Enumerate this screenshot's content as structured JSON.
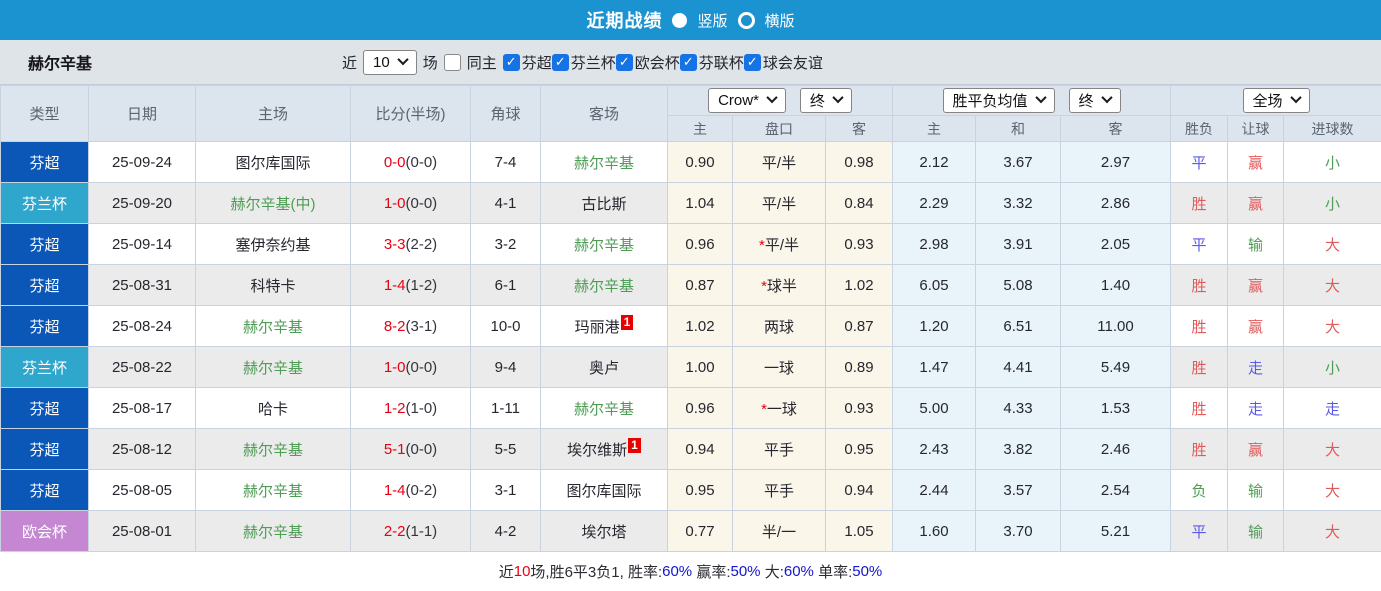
{
  "topbar": {
    "title": "近期战绩",
    "radio_vertical_label": "竖版",
    "radio_horizontal_label": "横版"
  },
  "filter": {
    "team": "赫尔辛基",
    "near_label": "近",
    "count_value": "10",
    "games_label": "场",
    "same_home_label": "同主",
    "leagues": [
      "芬超",
      "芬兰杯",
      "欧会杯",
      "芬联杯",
      "球会友谊"
    ]
  },
  "colors": {
    "topbar_blue": "#1c93d1",
    "league_super": "#0b57b8",
    "league_finnish_cup": "#2fa7cd",
    "league_conference": "#c687d2",
    "checkbox_blue": "#1673e6",
    "score_red": "#e60012",
    "team_green": "#4e9d55",
    "result_red": "#e05a5a",
    "result_blue": "#5a5ae6",
    "result_green": "#4e9d55",
    "footer_blue": "#1414cc"
  },
  "table": {
    "headers": {
      "type": "类型",
      "date": "日期",
      "home": "主场",
      "score": "比分(半场)",
      "corner": "角球",
      "away": "客场"
    },
    "controls": {
      "bookmaker": "Crow*",
      "final1": "终",
      "mean": "胜平负均值",
      "final2": "终",
      "fulltime": "全场"
    },
    "subheaders": [
      "主",
      "盘口",
      "客",
      "主",
      "和",
      "客",
      "胜负",
      "让球",
      "进球数"
    ],
    "rows": [
      {
        "league": "芬超",
        "league_color": "super",
        "date": "25-09-24",
        "home": "图尔库国际",
        "home_is_team": false,
        "score_ft": "0-0",
        "score_ht": "(0-0)",
        "corners": "7-4",
        "away": "赫尔辛基",
        "away_is_team": true,
        "away_badge": "",
        "odds_home": "0.90",
        "handicap_star": false,
        "handicap": "平/半",
        "odds_away": "0.98",
        "mean_home": "2.12",
        "mean_draw": "3.67",
        "mean_away": "2.97",
        "result_wdl": {
          "text": "平",
          "color": "blue"
        },
        "result_handicap": {
          "text": "赢",
          "color": "red"
        },
        "result_goals": {
          "text": "小",
          "color": "green"
        }
      },
      {
        "league": "芬兰杯",
        "league_color": "cupfi",
        "date": "25-09-20",
        "home": "赫尔辛基(中)",
        "home_is_team": true,
        "score_ft": "1-0",
        "score_ht": "(0-0)",
        "corners": "4-1",
        "away": "古比斯",
        "away_is_team": false,
        "away_badge": "",
        "odds_home": "1.04",
        "handicap_star": false,
        "handicap": "平/半",
        "odds_away": "0.84",
        "mean_home": "2.29",
        "mean_draw": "3.32",
        "mean_away": "2.86",
        "result_wdl": {
          "text": "胜",
          "color": "red"
        },
        "result_handicap": {
          "text": "赢",
          "color": "red"
        },
        "result_goals": {
          "text": "小",
          "color": "green"
        }
      },
      {
        "league": "芬超",
        "league_color": "super",
        "date": "25-09-14",
        "home": "塞伊奈约基",
        "home_is_team": false,
        "score_ft": "3-3",
        "score_ht": "(2-2)",
        "corners": "3-2",
        "away": "赫尔辛基",
        "away_is_team": true,
        "away_badge": "",
        "odds_home": "0.96",
        "handicap_star": true,
        "handicap": "平/半",
        "odds_away": "0.93",
        "mean_home": "2.98",
        "mean_draw": "3.91",
        "mean_away": "2.05",
        "result_wdl": {
          "text": "平",
          "color": "blue"
        },
        "result_handicap": {
          "text": "输",
          "color": "green"
        },
        "result_goals": {
          "text": "大",
          "color": "red"
        }
      },
      {
        "league": "芬超",
        "league_color": "super",
        "date": "25-08-31",
        "home": "科特卡",
        "home_is_team": false,
        "score_ft": "1-4",
        "score_ht": "(1-2)",
        "corners": "6-1",
        "away": "赫尔辛基",
        "away_is_team": true,
        "away_badge": "",
        "odds_home": "0.87",
        "handicap_star": true,
        "handicap": "球半",
        "odds_away": "1.02",
        "mean_home": "6.05",
        "mean_draw": "5.08",
        "mean_away": "1.40",
        "result_wdl": {
          "text": "胜",
          "color": "red"
        },
        "result_handicap": {
          "text": "赢",
          "color": "red"
        },
        "result_goals": {
          "text": "大",
          "color": "red"
        }
      },
      {
        "league": "芬超",
        "league_color": "super",
        "date": "25-08-24",
        "home": "赫尔辛基",
        "home_is_team": true,
        "score_ft": "8-2",
        "score_ht": "(3-1)",
        "corners": "10-0",
        "away": "玛丽港",
        "away_is_team": false,
        "away_badge": "1",
        "odds_home": "1.02",
        "handicap_star": false,
        "handicap": "两球",
        "odds_away": "0.87",
        "mean_home": "1.20",
        "mean_draw": "6.51",
        "mean_away": "11.00",
        "result_wdl": {
          "text": "胜",
          "color": "red"
        },
        "result_handicap": {
          "text": "赢",
          "color": "red"
        },
        "result_goals": {
          "text": "大",
          "color": "red"
        }
      },
      {
        "league": "芬兰杯",
        "league_color": "cupfi",
        "date": "25-08-22",
        "home": "赫尔辛基",
        "home_is_team": true,
        "score_ft": "1-0",
        "score_ht": "(0-0)",
        "corners": "9-4",
        "away": "奥卢",
        "away_is_team": false,
        "away_badge": "",
        "odds_home": "1.00",
        "handicap_star": false,
        "handicap": "一球",
        "odds_away": "0.89",
        "mean_home": "1.47",
        "mean_draw": "4.41",
        "mean_away": "5.49",
        "result_wdl": {
          "text": "胜",
          "color": "red"
        },
        "result_handicap": {
          "text": "走",
          "color": "blue"
        },
        "result_goals": {
          "text": "小",
          "color": "green"
        }
      },
      {
        "league": "芬超",
        "league_color": "super",
        "date": "25-08-17",
        "home": "哈卡",
        "home_is_team": false,
        "score_ft": "1-2",
        "score_ht": "(1-0)",
        "corners": "1-11",
        "away": "赫尔辛基",
        "away_is_team": true,
        "away_badge": "",
        "odds_home": "0.96",
        "handicap_star": true,
        "handicap": "一球",
        "odds_away": "0.93",
        "mean_home": "5.00",
        "mean_draw": "4.33",
        "mean_away": "1.53",
        "result_wdl": {
          "text": "胜",
          "color": "red"
        },
        "result_handicap": {
          "text": "走",
          "color": "blue"
        },
        "result_goals": {
          "text": "走",
          "color": "blue"
        }
      },
      {
        "league": "芬超",
        "league_color": "super",
        "date": "25-08-12",
        "home": "赫尔辛基",
        "home_is_team": true,
        "score_ft": "5-1",
        "score_ht": "(0-0)",
        "corners": "5-5",
        "away": "埃尔维斯",
        "away_is_team": false,
        "away_badge": "1",
        "odds_home": "0.94",
        "handicap_star": false,
        "handicap": "平手",
        "odds_away": "0.95",
        "mean_home": "2.43",
        "mean_draw": "3.82",
        "mean_away": "2.46",
        "result_wdl": {
          "text": "胜",
          "color": "red"
        },
        "result_handicap": {
          "text": "赢",
          "color": "red"
        },
        "result_goals": {
          "text": "大",
          "color": "red"
        }
      },
      {
        "league": "芬超",
        "league_color": "super",
        "date": "25-08-05",
        "home": "赫尔辛基",
        "home_is_team": true,
        "score_ft": "1-4",
        "score_ht": "(0-2)",
        "corners": "3-1",
        "away": "图尔库国际",
        "away_is_team": false,
        "away_badge": "",
        "odds_home": "0.95",
        "handicap_star": false,
        "handicap": "平手",
        "odds_away": "0.94",
        "mean_home": "2.44",
        "mean_draw": "3.57",
        "mean_away": "2.54",
        "result_wdl": {
          "text": "负",
          "color": "green"
        },
        "result_handicap": {
          "text": "输",
          "color": "green"
        },
        "result_goals": {
          "text": "大",
          "color": "red"
        }
      },
      {
        "league": "欧会杯",
        "league_color": "uefa",
        "date": "25-08-01",
        "home": "赫尔辛基",
        "home_is_team": true,
        "score_ft": "2-2",
        "score_ht": "(1-1)",
        "corners": "4-2",
        "away": "埃尔塔",
        "away_is_team": false,
        "away_badge": "",
        "odds_home": "0.77",
        "handicap_star": false,
        "handicap": "半/一",
        "odds_away": "1.05",
        "mean_home": "1.60",
        "mean_draw": "3.70",
        "mean_away": "5.21",
        "result_wdl": {
          "text": "平",
          "color": "blue"
        },
        "result_handicap": {
          "text": "输",
          "color": "green"
        },
        "result_goals": {
          "text": "大",
          "color": "red"
        }
      }
    ]
  },
  "footer": {
    "segments": [
      {
        "text": "近",
        "color": "dark"
      },
      {
        "text": "10",
        "color": "red"
      },
      {
        "text": "场,胜6平3负1, 胜率:",
        "color": "dark"
      },
      {
        "text": "60%",
        "color": "blue"
      },
      {
        "text": " 赢率:",
        "color": "dark"
      },
      {
        "text": "50%",
        "color": "blue"
      },
      {
        "text": " 大:",
        "color": "dark"
      },
      {
        "text": "60%",
        "color": "blue"
      },
      {
        "text": " 单率:",
        "color": "dark"
      },
      {
        "text": "50%",
        "color": "blue"
      }
    ]
  }
}
